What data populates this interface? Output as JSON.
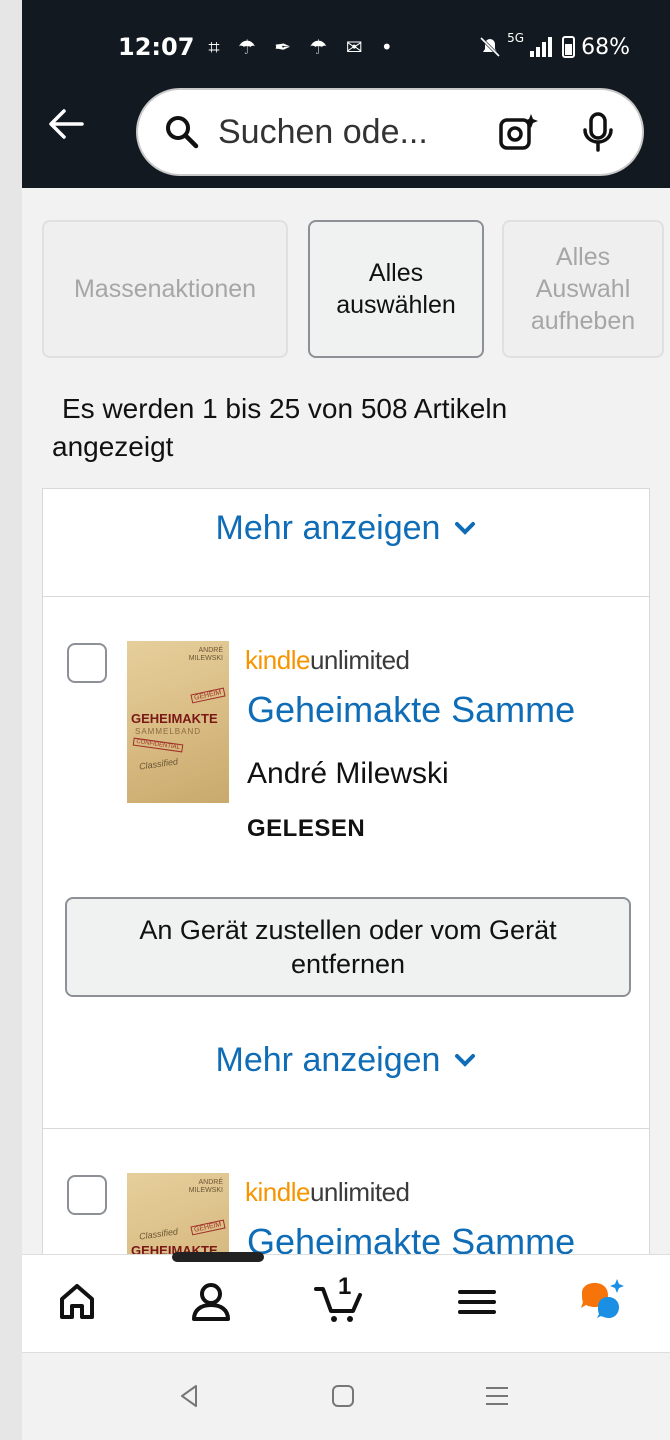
{
  "status_bar": {
    "time": "12:07",
    "notification_icons": "⌗ ☂ ✒ ☂ ✉ •",
    "network": "5G",
    "battery": "68%"
  },
  "search": {
    "placeholder": "Suchen ode..."
  },
  "bulk_actions": {
    "mass_actions_label": "Massenaktionen",
    "select_all_line1": "Alles",
    "select_all_line2": "auswählen",
    "deselect_line1": "Alles",
    "deselect_line2": "Auswahl",
    "deselect_line3": "aufheben"
  },
  "results": {
    "line1": "Es werden 1 bis 25 von 508 Artikeln",
    "line2": "angezeigt"
  },
  "show_more_label": "Mehr anzeigen",
  "items": [
    {
      "kindle_prefix": "kindle",
      "kindle_suffix": "unlimited",
      "title": "Geheimakte Samme",
      "author": "André Milewski",
      "read_status": "GELESEN",
      "deliver_label": "An Gerät zustellen oder vom Gerät entfernen",
      "cover": {
        "author_line1": "ANDRÉ",
        "author_line2": "MILEWSKI",
        "title": "GEHEIMAKTE",
        "subtitle": "SAMMELBAND",
        "stamp1": "GEHEIM",
        "stamp2": "CONFIDENTIAL",
        "scribble": "Classified"
      }
    },
    {
      "kindle_prefix": "kindle",
      "kindle_suffix": "unlimited",
      "title": "Geheimakte Samme",
      "cover": {
        "author_line1": "ANDRÉ",
        "author_line2": "MILEWSKI",
        "title": "GEHEIMAKTE",
        "stamp1": "GEHEIM",
        "scribble": "Classified"
      }
    }
  ],
  "bottom_nav": {
    "cart_count": "1"
  },
  "colors": {
    "header_bg": "#131921",
    "link": "#0f6cb6",
    "kindle_orange": "#f79400",
    "ai_orange": "#f7740b",
    "ai_blue": "#1a8fe3"
  }
}
